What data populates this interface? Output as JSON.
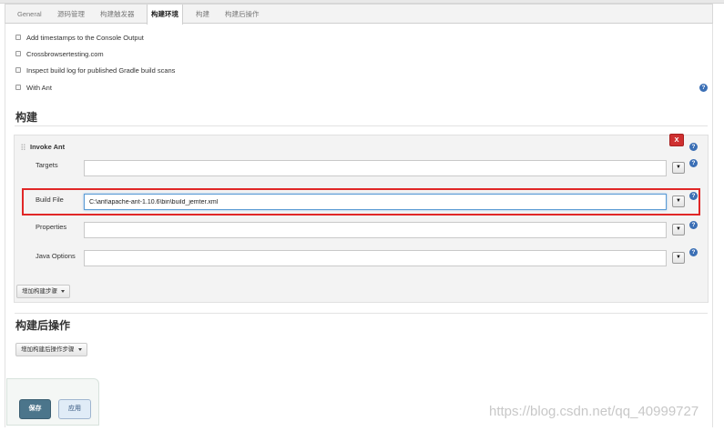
{
  "tabs": [
    {
      "label": "General",
      "active": false
    },
    {
      "label": "源码管理",
      "active": false
    },
    {
      "label": "构建触发器",
      "active": false
    },
    {
      "label": "构建环境",
      "active": true
    },
    {
      "label": "构建",
      "active": false
    },
    {
      "label": "构建后操作",
      "active": false
    }
  ],
  "build_env": {
    "options": [
      {
        "label": "Add timestamps to the Console Output",
        "checked": false
      },
      {
        "label": "Crossbrowsertesting.com",
        "checked": false
      },
      {
        "label": "Inspect build log for published Gradle build scans",
        "checked": false
      },
      {
        "label": "With Ant",
        "checked": false
      }
    ]
  },
  "build": {
    "title": "构建",
    "step": {
      "title": "Invoke Ant",
      "delete_label": "X",
      "fields": [
        {
          "label": "Targets",
          "value": ""
        },
        {
          "label": "Build File",
          "value": "C:\\ant\\apache-ant-1.10.6\\bin\\build_jemter.xml"
        },
        {
          "label": "Properties",
          "value": ""
        },
        {
          "label": "Java Options",
          "value": ""
        }
      ],
      "dropdown_glyph": "▼"
    },
    "add_step_label": "增加构建步骤"
  },
  "post_build": {
    "title": "构建后操作",
    "add_step_label": "增加构建后操作步骤"
  },
  "actions": {
    "save_label": "保存",
    "apply_label": "应用"
  },
  "help_glyph": "?",
  "icons": {
    "help": "help-icon",
    "checkbox": "checkbox-icon",
    "drag": "drag-handle-icon",
    "dropdown": "chevron-down-icon"
  },
  "colors": {
    "save_button": "#4b758b",
    "delete_button": "#cf3030",
    "help_icon": "#3b6fb5",
    "highlight": "#e02727"
  },
  "watermark": "https://blog.csdn.net/qq_40999727"
}
